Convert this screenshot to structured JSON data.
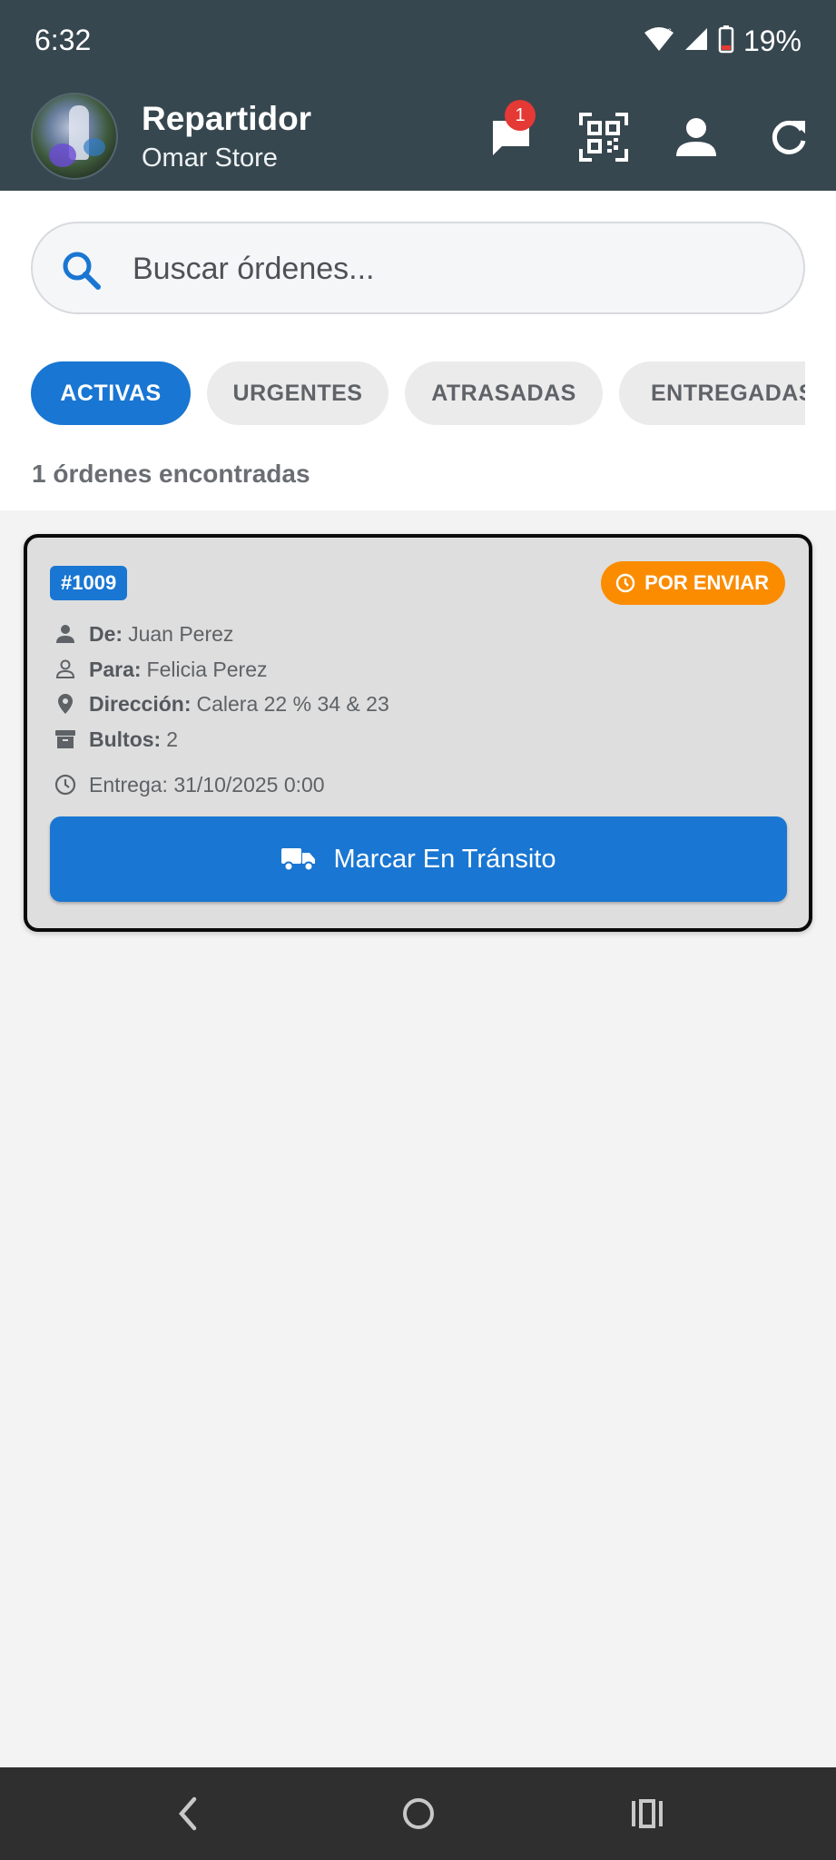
{
  "status_bar": {
    "time": "6:32",
    "battery": "19%",
    "icons": [
      "wifi-icon",
      "signal-icon",
      "battery-icon"
    ]
  },
  "header": {
    "title": "Repartidor",
    "subtitle": "Omar Store",
    "chat_badge_count": "1",
    "icons": [
      "chat-icon",
      "qr-code-icon",
      "person-icon",
      "refresh-icon"
    ],
    "background_color": "#37474f"
  },
  "search": {
    "placeholder": "Buscar órdenes...",
    "value": ""
  },
  "filters": {
    "tabs": [
      {
        "label": "ACTIVAS",
        "selected": true
      },
      {
        "label": "URGENTES",
        "selected": false
      },
      {
        "label": "ATRASADAS",
        "selected": false
      },
      {
        "label": "ENTREGADAS",
        "selected": false
      }
    ]
  },
  "results": {
    "count_text": "1 órdenes encontradas"
  },
  "orders": [
    {
      "id": "#1009",
      "status": "POR ENVIAR",
      "status_color": "#fb8c00",
      "from_label": "De:",
      "from": "Juan Perez",
      "to_label": "Para:",
      "to": "Felicia Perez",
      "address_label": "Dirección:",
      "address": "Calera 22 % 34 & 23",
      "packages_label": "Bultos:",
      "packages": "2",
      "delivery": "Entrega: 31/10/2025 0:00",
      "action_label": "Marcar En Tránsito"
    }
  ],
  "colors": {
    "primary": "#1976d2",
    "page_background": "#f3f3f3"
  }
}
